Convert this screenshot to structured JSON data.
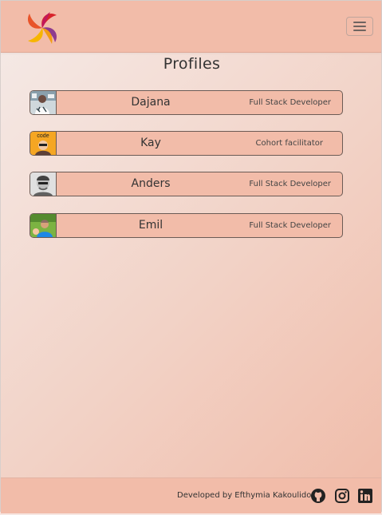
{
  "header": {
    "logo_icon": "swirl-logo-icon",
    "menu_icon": "hamburger-menu-icon"
  },
  "main": {
    "title": "Profiles",
    "profiles": [
      {
        "name": "Dajana",
        "role": "Full Stack Developer"
      },
      {
        "name": "Kay",
        "role": "Cohort facilitator"
      },
      {
        "name": "Anders",
        "role": "Full Stack Developer"
      },
      {
        "name": "Emil",
        "role": "Full Stack Developer"
      }
    ]
  },
  "footer": {
    "credit": "Developed by Efthymia Kakoulidou",
    "icons": [
      "github-icon",
      "instagram-icon",
      "linkedin-icon"
    ]
  },
  "colors": {
    "accent": "#f2bca9",
    "border": "#6b5b55"
  }
}
